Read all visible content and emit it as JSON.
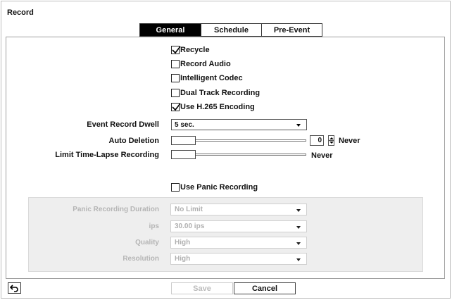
{
  "window": {
    "title": "Record"
  },
  "tabs": [
    {
      "label": "General",
      "active": true
    },
    {
      "label": "Schedule",
      "active": false
    },
    {
      "label": "Pre-Event",
      "active": false
    }
  ],
  "options": {
    "recycle": {
      "label": "Recycle",
      "checked": true
    },
    "record_audio": {
      "label": "Record Audio",
      "checked": false
    },
    "intelligent_codec": {
      "label": "Intelligent Codec",
      "checked": false
    },
    "dual_track": {
      "label": "Dual Track Recording",
      "checked": false
    },
    "h265": {
      "label": "Use H.265 Encoding",
      "checked": true
    }
  },
  "event_record_dwell": {
    "label": "Event Record Dwell",
    "value": "5 sec."
  },
  "auto_deletion": {
    "label": "Auto Deletion",
    "spin_value": "0",
    "text": "Never"
  },
  "limit_timelapse": {
    "label": "Limit Time-Lapse Recording",
    "text": "Never"
  },
  "panic": {
    "checkbox": {
      "label": "Use Panic Recording",
      "checked": false
    },
    "duration": {
      "label": "Panic Recording Duration",
      "value": "No Limit"
    },
    "ips": {
      "label": "ips",
      "value": "30.00 ips"
    },
    "quality": {
      "label": "Quality",
      "value": "High"
    },
    "resolution": {
      "label": "Resolution",
      "value": "High"
    }
  },
  "footer": {
    "save_label": "Save",
    "cancel_label": "Cancel"
  },
  "icons": {
    "back": "back-arrow-icon",
    "check": "checkmark-icon",
    "caret": "chevron-down-icon"
  }
}
